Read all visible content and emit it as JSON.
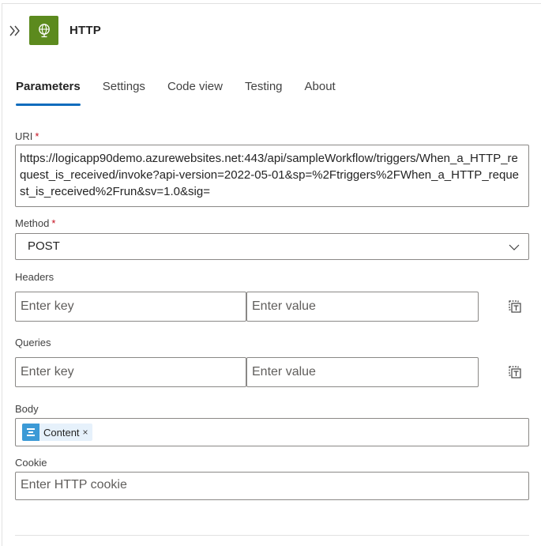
{
  "header": {
    "title": "HTTP",
    "icon": "globe-icon",
    "icon_bg": "#5c8a1e"
  },
  "tabs": [
    {
      "label": "Parameters",
      "active": true
    },
    {
      "label": "Settings",
      "active": false
    },
    {
      "label": "Code view",
      "active": false
    },
    {
      "label": "Testing",
      "active": false
    },
    {
      "label": "About",
      "active": false
    }
  ],
  "fields": {
    "uri": {
      "label": "URI",
      "required_mark": "*",
      "value": "https://logicapp90demo.azurewebsites.net:443/api/sampleWorkflow/triggers/When_a_HTTP_request_is_received/invoke?api-version=2022-05-01&sp=%2Ftriggers%2FWhen_a_HTTP_request_is_received%2Frun&sv=1.0&sig="
    },
    "method": {
      "label": "Method",
      "required_mark": "*",
      "value": "POST"
    },
    "headers": {
      "label": "Headers",
      "key_placeholder": "Enter key",
      "value_placeholder": "Enter value"
    },
    "queries": {
      "label": "Queries",
      "key_placeholder": "Enter key",
      "value_placeholder": "Enter value"
    },
    "body": {
      "label": "Body",
      "token_label": "Content",
      "token_remove": "×",
      "token_color": "#3c9ad6"
    },
    "cookie": {
      "label": "Cookie",
      "placeholder": "Enter HTTP cookie"
    }
  },
  "colors": {
    "accent": "#0f6cbd",
    "required": "#c50f1f"
  }
}
